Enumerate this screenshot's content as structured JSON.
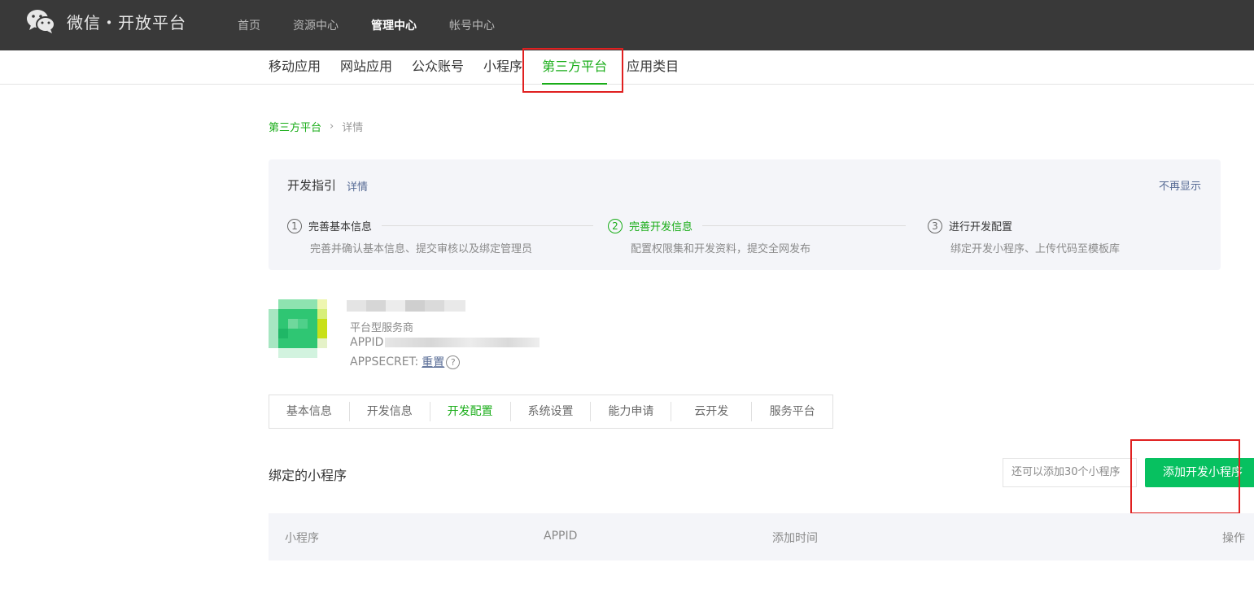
{
  "header": {
    "logo_text": "微信・开放平台",
    "nav": [
      {
        "label": "首页",
        "active": false
      },
      {
        "label": "资源中心",
        "active": false
      },
      {
        "label": "管理中心",
        "active": true
      },
      {
        "label": "帐号中心",
        "active": false
      }
    ]
  },
  "subnav": {
    "items": [
      {
        "label": "移动应用",
        "active": false
      },
      {
        "label": "网站应用",
        "active": false
      },
      {
        "label": "公众账号",
        "active": false
      },
      {
        "label": "小程序",
        "active": false
      },
      {
        "label": "第三方平台",
        "active": true
      },
      {
        "label": "应用类目",
        "active": false
      }
    ]
  },
  "breadcrumb": {
    "parent": "第三方平台",
    "separator": "›",
    "current": "详情"
  },
  "guide": {
    "title": "开发指引",
    "detail_link": "详情",
    "dismiss": "不再显示",
    "steps": [
      {
        "num": "1",
        "title": "完善基本信息",
        "desc": "完善并确认基本信息、提交审核以及绑定管理员",
        "active": false
      },
      {
        "num": "2",
        "title": "完善开发信息",
        "desc": "配置权限集和开发资料，提交全网发布",
        "active": true
      },
      {
        "num": "3",
        "title": "进行开发配置",
        "desc": "绑定开发小程序、上传代码至模板库",
        "active": false
      }
    ]
  },
  "app": {
    "type_label": "平台型服务商",
    "appid_label": "APPID",
    "appsecret_label": "APPSECRET:",
    "reset_link": "重置",
    "help_icon": "?"
  },
  "tabs": [
    {
      "label": "基本信息",
      "active": false
    },
    {
      "label": "开发信息",
      "active": false
    },
    {
      "label": "开发配置",
      "active": true
    },
    {
      "label": "系统设置",
      "active": false
    },
    {
      "label": "能力申请",
      "active": false
    },
    {
      "label": "云开发",
      "active": false
    },
    {
      "label": "服务平台",
      "active": false
    }
  ],
  "bound": {
    "title": "绑定的小程序",
    "quota_text": "还可以添加30个小程序",
    "add_button": "添加开发小程序",
    "columns": [
      "小程序",
      "APPID",
      "添加时间",
      "操作"
    ]
  },
  "colors": {
    "accent": "#1aad19",
    "button": "#07c160",
    "highlight": "#e02020",
    "topbar": "#393939"
  },
  "icons": {
    "logo": "wechat-logo-icon",
    "help": "question-circle-icon"
  }
}
